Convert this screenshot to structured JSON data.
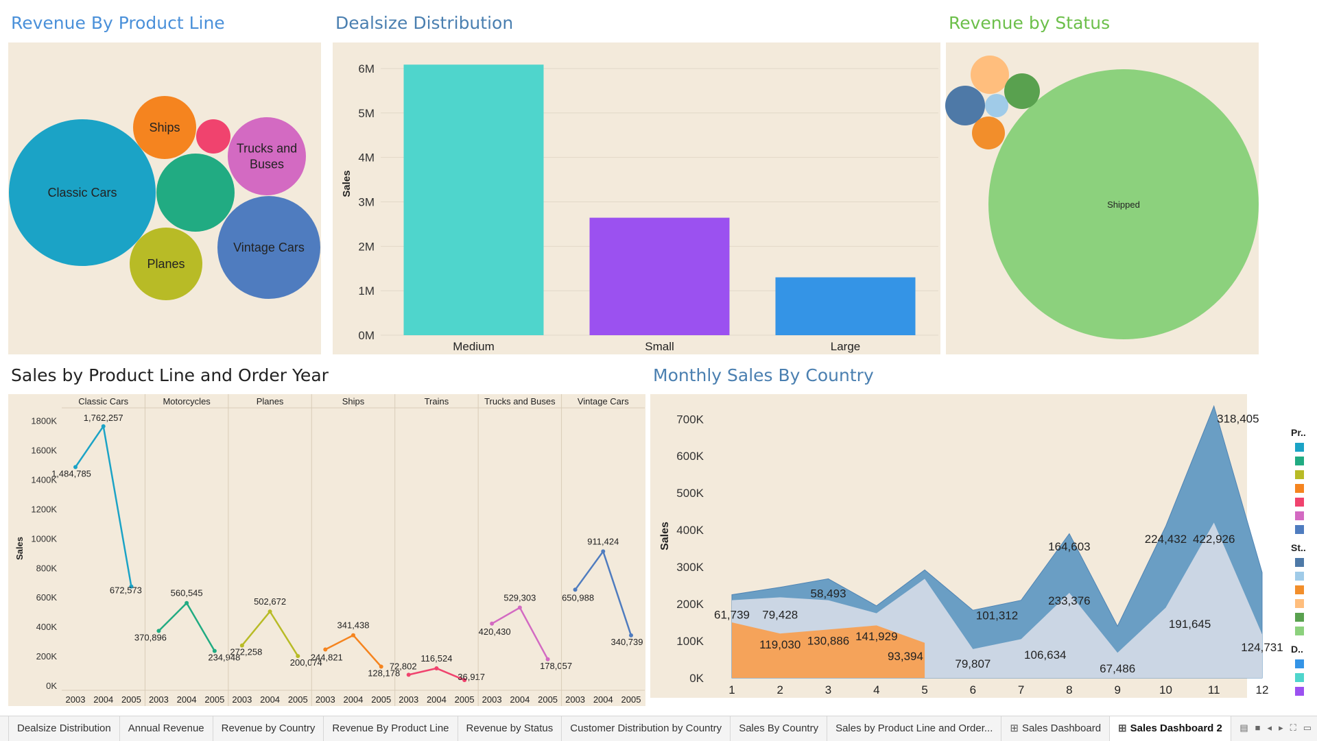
{
  "titles": {
    "product_line": "Revenue By Product Line",
    "dealsize": "Dealsize Distribution",
    "status": "Revenue by Status",
    "sales_line_year": "Sales by Product Line and Order Year",
    "monthly": "Monthly Sales By Country"
  },
  "colors": {
    "title_blue": "#4a90d9",
    "title_green": "#6cbf4a",
    "title_dark": "#222222",
    "title_steel": "#4a7fb0",
    "panel_bg": "#f3eadb"
  },
  "chart_data": [
    {
      "id": "product_line",
      "type": "bubble",
      "title": "Revenue By Product Line",
      "bubbles": [
        {
          "label": "Classic Cars",
          "color": "#1ba3c6"
        },
        {
          "label": "Ships",
          "color": "#f5841f"
        },
        {
          "label": "",
          "color": "#f0436e"
        },
        {
          "label": "Trucks and Buses",
          "color": "#d36ac2"
        },
        {
          "label": "",
          "color": "#21ab82"
        },
        {
          "label": "Vintage Cars",
          "color": "#4f7cbf"
        },
        {
          "label": "Planes",
          "color": "#b8bb26"
        }
      ]
    },
    {
      "id": "dealsize",
      "type": "bar",
      "title": "Dealsize Distribution",
      "ylabel": "Sales",
      "categories": [
        "Medium",
        "Small",
        "Large"
      ],
      "values": [
        6087432,
        2643077,
        1302119
      ],
      "colors": [
        "#4fd5cc",
        "#9b51f0",
        "#3494e6"
      ],
      "yticks": [
        "0M",
        "1M",
        "2M",
        "3M",
        "4M",
        "5M",
        "6M"
      ],
      "ylim": [
        0,
        6400000
      ],
      "grid": true
    },
    {
      "id": "status",
      "type": "bubble",
      "title": "Revenue by Status",
      "bubbles": [
        {
          "label": "Shipped",
          "color": "#8cd17d"
        },
        {
          "label": "",
          "color": "#ffbe7d"
        },
        {
          "label": "",
          "color": "#59a14f"
        },
        {
          "label": "",
          "color": "#4e79a7"
        },
        {
          "label": "",
          "color": "#a0cbe8"
        },
        {
          "label": "",
          "color": "#f28e2b"
        }
      ]
    },
    {
      "id": "sales_line_year",
      "type": "line",
      "title": "Sales by Product Line and Order Year",
      "ylabel": "Sales",
      "yticks": [
        "0K",
        "200K",
        "400K",
        "600K",
        "800K",
        "1000K",
        "1200K",
        "1400K",
        "1600K",
        "1800K"
      ],
      "ylim": [
        0,
        1850000
      ],
      "x": [
        "2003",
        "2004",
        "2005"
      ],
      "series": [
        {
          "name": "Classic Cars",
          "color": "#1ba3c6",
          "values": [
            1484785,
            1762257,
            672573
          ],
          "labels": [
            "1,484,785",
            "1,762,257",
            "672,573"
          ]
        },
        {
          "name": "Motorcycles",
          "color": "#21ab82",
          "values": [
            370896,
            560545,
            234948
          ],
          "labels": [
            "370,896",
            "560,545",
            "234,948"
          ]
        },
        {
          "name": "Planes",
          "color": "#b8bb26",
          "values": [
            272258,
            502672,
            200074
          ],
          "labels": [
            "272,258",
            "502,672",
            "200,074"
          ]
        },
        {
          "name": "Ships",
          "color": "#f5841f",
          "values": [
            244821,
            341438,
            128178
          ],
          "labels": [
            "244,821",
            "341,438",
            "128,178"
          ]
        },
        {
          "name": "Trains",
          "color": "#f0436e",
          "values": [
            72802,
            116524,
            36917
          ],
          "labels": [
            "72,802",
            "116,524",
            "36,917"
          ]
        },
        {
          "name": "Trucks and Buses",
          "color": "#d36ac2",
          "values": [
            420430,
            529303,
            178057
          ],
          "labels": [
            "420,430",
            "529,303",
            "178,057"
          ]
        },
        {
          "name": "Vintage Cars",
          "color": "#4f7cbf",
          "values": [
            650988,
            911424,
            340739
          ],
          "labels": [
            "650,988",
            "911,424",
            "340,739"
          ]
        }
      ]
    },
    {
      "id": "monthly",
      "type": "area",
      "title": "Monthly Sales By Country",
      "ylabel": "Sales",
      "yticks": [
        "0K",
        "100K",
        "200K",
        "300K",
        "400K",
        "500K",
        "600K",
        "700K"
      ],
      "ylim": [
        0,
        745000
      ],
      "x": [
        "1",
        "2",
        "3",
        "4",
        "5",
        "6",
        "7",
        "8",
        "9",
        "10",
        "11",
        "12"
      ],
      "series": [
        {
          "color": "#6a9ec4",
          "values": [
            225000,
            245000,
            268000,
            195000,
            292000,
            183000,
            210000,
            390000,
            140000,
            410000,
            735000,
            285000
          ]
        },
        {
          "color": "#cbd6e4",
          "values": [
            210000,
            218000,
            210000,
            175000,
            268000,
            78000,
            105000,
            230000,
            68000,
            190000,
            420000,
            118000
          ]
        },
        {
          "color": "#f5a35a",
          "values": [
            150000,
            120000,
            131000,
            142000,
            95000,
            null,
            null,
            null,
            null,
            null,
            null,
            null
          ]
        }
      ],
      "data_labels": [
        {
          "text": "61,739",
          "x": 1,
          "y": 160000
        },
        {
          "text": "79,428",
          "x": 2,
          "y": 160000
        },
        {
          "text": "58,493",
          "x": 3,
          "y": 218000
        },
        {
          "text": "119,030",
          "x": 2,
          "y": 80000
        },
        {
          "text": "130,886",
          "x": 3,
          "y": 90000
        },
        {
          "text": "141,929",
          "x": 4,
          "y": 102000
        },
        {
          "text": "93,394",
          "x": 4.6,
          "y": 48000
        },
        {
          "text": "101,312",
          "x": 6.5,
          "y": 158000
        },
        {
          "text": "79,807",
          "x": 6,
          "y": 28000
        },
        {
          "text": "106,634",
          "x": 7.5,
          "y": 52000
        },
        {
          "text": "164,603",
          "x": 8,
          "y": 345000
        },
        {
          "text": "233,376",
          "x": 8,
          "y": 198000
        },
        {
          "text": "67,486",
          "x": 9,
          "y": 15000
        },
        {
          "text": "224,432",
          "x": 10,
          "y": 365000
        },
        {
          "text": "422,926",
          "x": 11,
          "y": 365000
        },
        {
          "text": "191,645",
          "x": 10.5,
          "y": 135000
        },
        {
          "text": "318,405",
          "x": 11.5,
          "y": 690000
        },
        {
          "text": "124,731",
          "x": 12,
          "y": 72000
        }
      ]
    }
  ],
  "legend": {
    "groups": [
      {
        "title": "Pr..",
        "colors": [
          "#1ba3c6",
          "#21ab82",
          "#b8bb26",
          "#f5841f",
          "#f0436e",
          "#d36ac2",
          "#4f7cbf"
        ]
      },
      {
        "title": "St..",
        "colors": [
          "#4e79a7",
          "#a0cbe8",
          "#f28e2b",
          "#ffbe7d",
          "#59a14f",
          "#8cd17d"
        ]
      },
      {
        "title": "D..",
        "colors": [
          "#3494e6",
          "#4fd5cc",
          "#9b51f0"
        ]
      }
    ]
  },
  "tabs": [
    {
      "label": "Dealsize Distribution",
      "icon": "",
      "active": false
    },
    {
      "label": "Annual Revenue",
      "icon": "",
      "active": false
    },
    {
      "label": "Revenue by Country",
      "icon": "",
      "active": false
    },
    {
      "label": "Revenue By Product Line",
      "icon": "",
      "active": false
    },
    {
      "label": "Revenue by Status",
      "icon": "",
      "active": false
    },
    {
      "label": "Customer Distribution by Country",
      "icon": "",
      "active": false
    },
    {
      "label": "Sales By Country",
      "icon": "",
      "active": false
    },
    {
      "label": "Sales by Product Line and Order...",
      "icon": "",
      "active": false
    },
    {
      "label": "Sales Dashboard",
      "icon": "⊞",
      "active": false
    },
    {
      "label": "Sales Dashboard 2",
      "icon": "⊞",
      "active": true
    }
  ]
}
